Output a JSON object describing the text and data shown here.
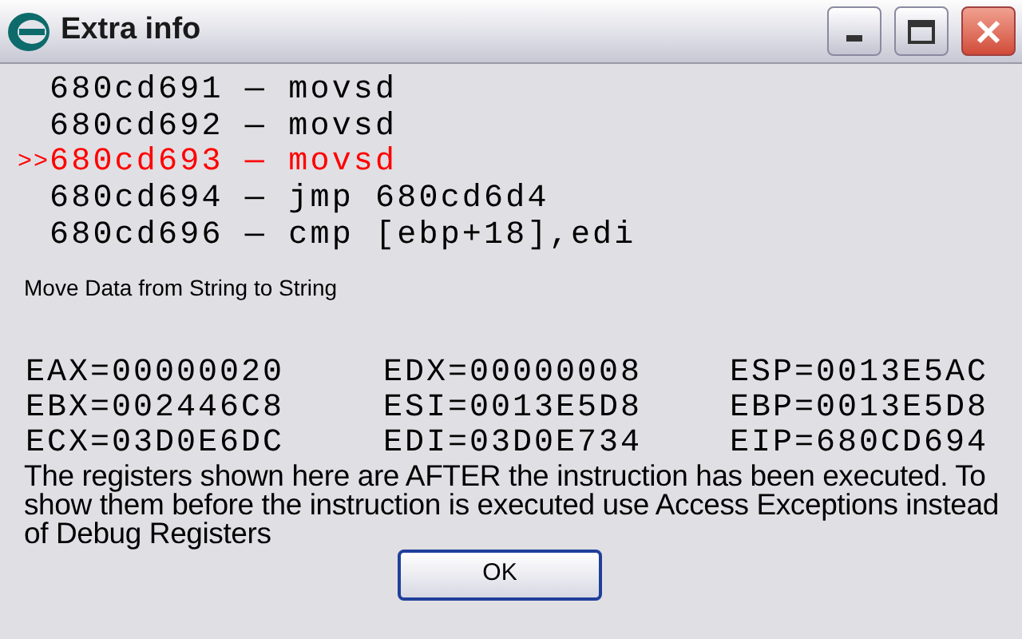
{
  "window": {
    "title": "Extra info"
  },
  "current_marker": ">>",
  "instructions": [
    {
      "text": "680cd691 — movsd",
      "selected": false
    },
    {
      "text": "680cd692 — movsd",
      "selected": false
    },
    {
      "text": "680cd693 — movsd",
      "selected": true
    },
    {
      "text": "680cd694 — jmp 680cd6d4",
      "selected": false
    },
    {
      "text": "680cd696 — cmp [ebp+18],edi",
      "selected": false
    }
  ],
  "description": "Move Data from String to String",
  "registers": [
    [
      "EAX=00000020",
      "EDX=00000008",
      "ESP=0013E5AC"
    ],
    [
      "EBX=002446C8",
      "ESI=0013E5D8",
      "EBP=0013E5D8"
    ],
    [
      "ECX=03D0E6DC",
      "EDI=03D0E734",
      "EIP=680CD694"
    ]
  ],
  "note": "The registers shown here are AFTER the instruction has been executed. To show them before the instruction is executed use Access Exceptions instead of Debug Registers",
  "buttons": [
    "OK"
  ]
}
